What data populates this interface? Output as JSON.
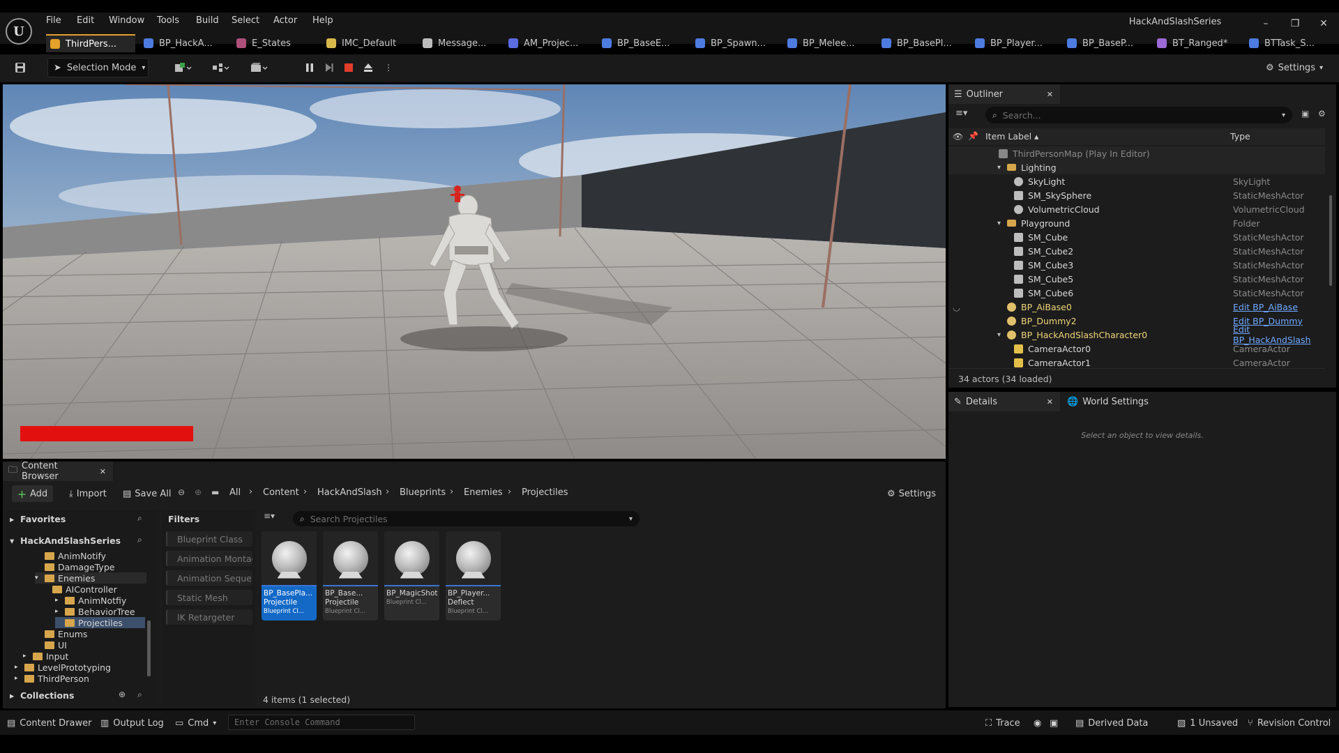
{
  "app_title": "HackAndSlashSeries",
  "menu": [
    "File",
    "Edit",
    "Window",
    "Tools",
    "Build",
    "Select",
    "Actor",
    "Help"
  ],
  "tabs": [
    {
      "label": "ThirdPers...",
      "color": "#e4a12b"
    },
    {
      "label": "BP_HackA...",
      "color": "#4d7be0"
    },
    {
      "label": "E_States",
      "color": "#b04f7a"
    },
    {
      "label": "IMC_Default",
      "color": "#d8b84a"
    },
    {
      "label": "Message...",
      "color": "#bdbdbd"
    },
    {
      "label": "AM_Projec...",
      "color": "#5b6be0"
    },
    {
      "label": "BP_BaseE...",
      "color": "#4d7be0"
    },
    {
      "label": "BP_Spawn...",
      "color": "#4d7be0"
    },
    {
      "label": "BP_Melee...",
      "color": "#4d7be0"
    },
    {
      "label": "BP_BasePl...",
      "color": "#4d7be0"
    },
    {
      "label": "BP_Player...",
      "color": "#4d7be0"
    },
    {
      "label": "BP_BaseP...",
      "color": "#4d7be0"
    },
    {
      "label": "BT_Ranged*",
      "color": "#9b6ad6"
    },
    {
      "label": "BTTask_S...",
      "color": "#4d7be0"
    }
  ],
  "toolbar": {
    "selection_mode": "Selection Mode",
    "settings": "Settings"
  },
  "outliner": {
    "title": "Outliner",
    "search_placeholder": "Search...",
    "col_label": "Item Label",
    "col_type": "Type",
    "rows": [
      {
        "label": "ThirdPersonMap (Play In Editor)",
        "type": "",
        "icon": "map-icon",
        "link": false
      },
      {
        "label": "Lighting",
        "type": "",
        "icon": "folder-icon",
        "link": false
      },
      {
        "label": "SkyLight",
        "type": "SkyLight",
        "icon": "skylight-icon",
        "link": false
      },
      {
        "label": "SM_SkySphere",
        "type": "StaticMeshActor",
        "icon": "mesh-icon",
        "link": false
      },
      {
        "label": "VolumetricCloud",
        "type": "VolumetricCloud",
        "icon": "cloud-icon",
        "link": false
      },
      {
        "label": "Playground",
        "type": "Folder",
        "icon": "folder-icon",
        "link": false
      },
      {
        "label": "SM_Cube",
        "type": "StaticMeshActor",
        "icon": "mesh-icon",
        "link": false
      },
      {
        "label": "SM_Cube2",
        "type": "StaticMeshActor",
        "icon": "mesh-icon",
        "link": false
      },
      {
        "label": "SM_Cube3",
        "type": "StaticMeshActor",
        "icon": "mesh-icon",
        "link": false
      },
      {
        "label": "SM_Cube5",
        "type": "StaticMeshActor",
        "icon": "mesh-icon",
        "link": false
      },
      {
        "label": "SM_Cube6",
        "type": "StaticMeshActor",
        "icon": "mesh-icon",
        "link": false
      },
      {
        "label": "BP_AiBase0",
        "type": "Edit BP_AiBase",
        "icon": "pawn-icon",
        "link": true
      },
      {
        "label": "BP_Dummy2",
        "type": "Edit BP_Dummy",
        "icon": "pawn-icon",
        "link": true
      },
      {
        "label": "BP_HackAndSlashCharacter0",
        "type": "Edit BP_HackAndSlash",
        "icon": "pawn-icon",
        "link": true
      },
      {
        "label": "CameraActor0",
        "type": "CameraActor",
        "icon": "camera-icon",
        "link": false
      },
      {
        "label": "CameraActor1",
        "type": "CameraActor",
        "icon": "camera-icon",
        "link": false
      }
    ],
    "actor_count": "34 actors (34 loaded)"
  },
  "details": {
    "title": "Details",
    "world_settings": "World Settings",
    "empty_text": "Select an object to view details."
  },
  "content_browser": {
    "title": "Content Browser",
    "add": "Add",
    "import": "Import",
    "save_all": "Save All",
    "breadcrumb": [
      "All",
      "Content",
      "HackAndSlash",
      "Blueprints",
      "Enemies",
      "Projectiles"
    ],
    "settings": "Settings",
    "favorites": "Favorites",
    "root": "HackAndSlashSeries",
    "tree": [
      "AnimNotify",
      "DamageType",
      "Enemies",
      "AIController",
      "AnimNotfiy",
      "BehaviorTree",
      "Projectiles",
      "Enums",
      "UI",
      "Input",
      "LevelPrototyping",
      "ThirdPerson"
    ],
    "collections": "Collections",
    "filters_title": "Filters",
    "filters": [
      "Blueprint Class",
      "Animation Montage",
      "Animation Sequence",
      "Static Mesh",
      "IK Retargeter"
    ],
    "search_placeholder": "Search Projectiles",
    "assets": [
      {
        "name1": "BP_BasePla...",
        "name2": "Projectile",
        "kind": "Blueprint Cl...",
        "selected": true
      },
      {
        "name1": "BP_Base...",
        "name2": "Projectile",
        "kind": "Blueprint Cl...",
        "selected": false
      },
      {
        "name1": "BP_MagicShot",
        "name2": "",
        "kind": "Blueprint Cl...",
        "selected": false
      },
      {
        "name1": "BP_Player...",
        "name2": "Deflect",
        "kind": "Blueprint Cl...",
        "selected": false
      }
    ],
    "items_count": "4 items (1 selected)"
  },
  "statusbar": {
    "content_drawer": "Content Drawer",
    "output_log": "Output Log",
    "cmd": "Cmd",
    "console_placeholder": "Enter Console Command",
    "trace": "Trace",
    "derived_data": "Derived Data",
    "unsaved": "1 Unsaved",
    "revision_control": "Revision Control"
  },
  "colors": {
    "accent": "#e4a12b",
    "selection": "#1469c7",
    "health": "#e31010"
  }
}
